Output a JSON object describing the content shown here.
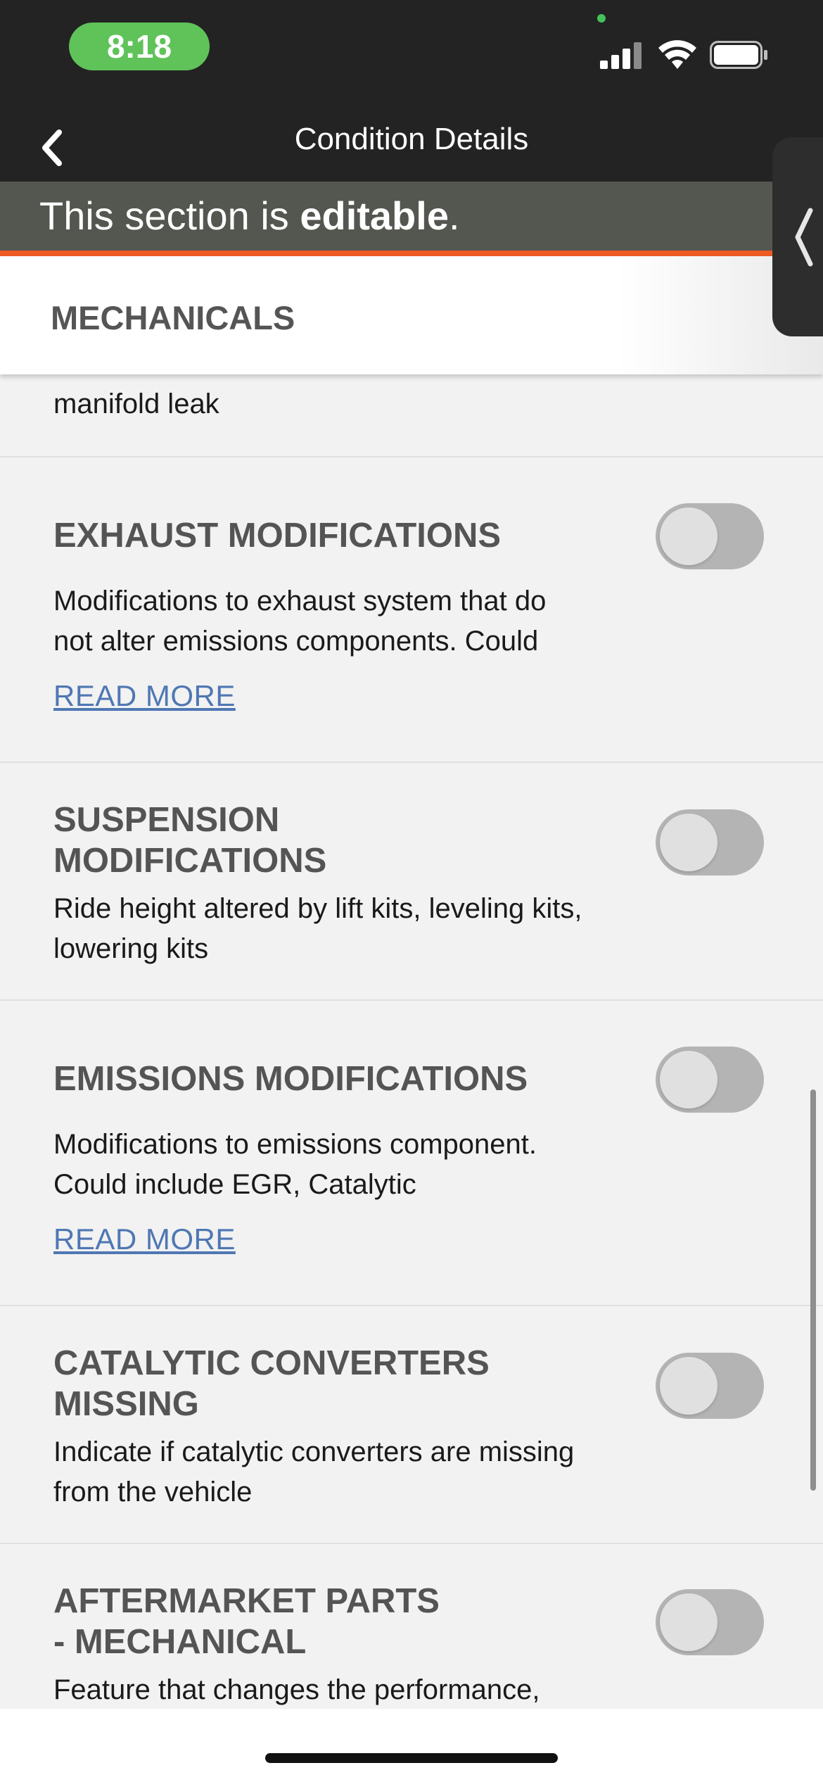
{
  "status_bar": {
    "time": "8:18"
  },
  "header": {
    "title": "Condition Details"
  },
  "banner": {
    "prefix": "This section is ",
    "emphasis": "editable",
    "suffix": "."
  },
  "section": {
    "title": "MECHANICALS"
  },
  "partial_item": {
    "text": "manifold leak"
  },
  "items": [
    {
      "title": "EXHAUST MODIFICATIONS",
      "description_line1": "Modifications to exhaust system that do",
      "description_line2": "not alter emissions components. Could",
      "read_more": "READ MORE",
      "toggle_on": false
    },
    {
      "title_line1": "SUSPENSION",
      "title_line2": "MODIFICATIONS",
      "description_line1": "Ride height altered by lift kits, leveling kits,",
      "description_line2": "lowering kits",
      "toggle_on": false
    },
    {
      "title": "EMISSIONS MODIFICATIONS",
      "description_line1": "Modifications to emissions component.",
      "description_line2": "Could include EGR, Catalytic",
      "read_more": "READ MORE",
      "toggle_on": false
    },
    {
      "title_line1": "CATALYTIC CONVERTERS",
      "title_line2": "MISSING",
      "description_line1": "Indicate if catalytic converters are missing",
      "description_line2": "from the vehicle",
      "toggle_on": false
    },
    {
      "title_line1": "AFTERMARKET PARTS",
      "title_line2": "- MECHANICAL",
      "description_line1": "Feature that changes the performance,",
      "toggle_on": false
    }
  ],
  "icons": {
    "back": "chevron-left-icon",
    "drawer": "chevron-left-icon",
    "signal": "cellular-signal-icon",
    "wifi": "wifi-icon",
    "battery": "battery-icon"
  },
  "colors": {
    "status_bar_bg": "#232323",
    "time_pill": "#5fc35a",
    "banner_bg": "#545750",
    "banner_accent": "#ee5a24",
    "link": "#4f77b3",
    "toggle_off": "#b4b4b4"
  }
}
